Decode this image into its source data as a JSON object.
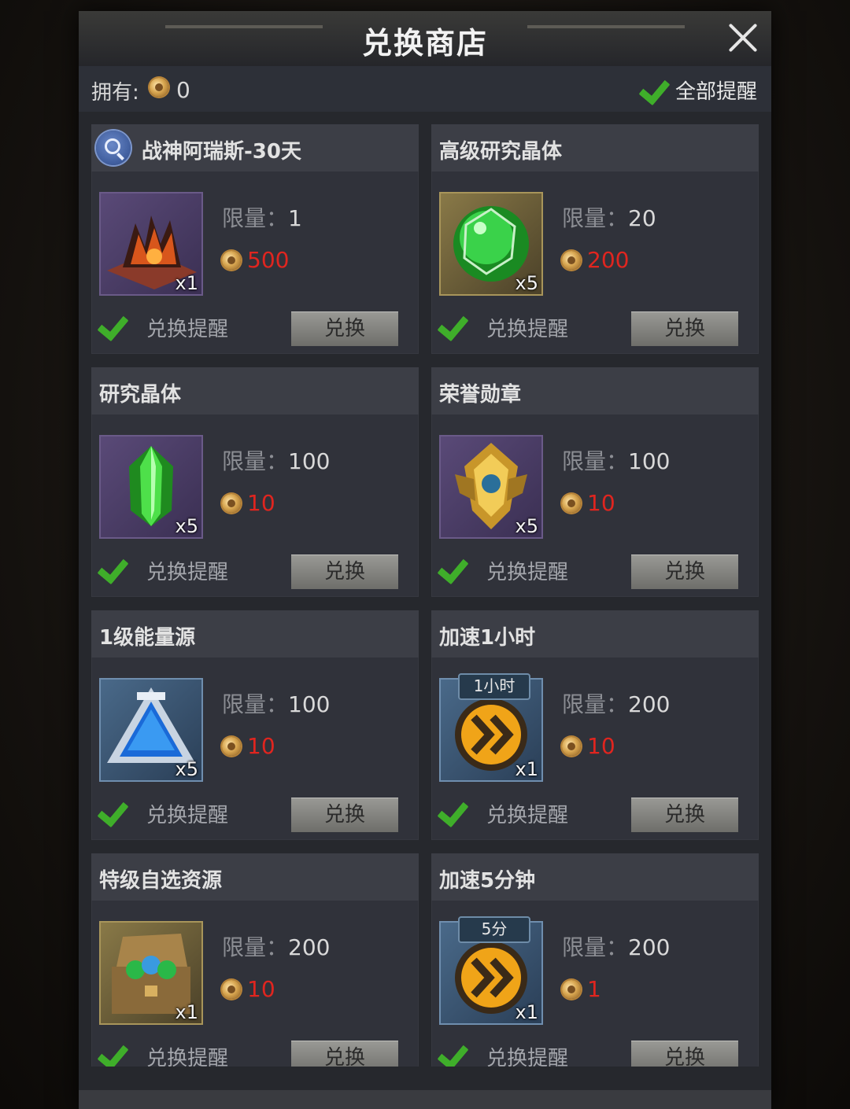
{
  "window": {
    "title": "兑换商店"
  },
  "owned": {
    "label": "拥有:",
    "count": "0"
  },
  "remind_all": {
    "label": "全部提醒"
  },
  "items": [
    {
      "title": "战神阿瑞斯-30天",
      "qty": "x1",
      "limit_label": "限量：",
      "limit": "1",
      "price": "500",
      "remind_label": "兑换提醒",
      "button_label": "兑换"
    },
    {
      "title": "高级研究晶体",
      "qty": "x5",
      "limit_label": "限量：",
      "limit": "20",
      "price": "200",
      "remind_label": "兑换提醒",
      "button_label": "兑换"
    },
    {
      "title": "研究晶体",
      "qty": "x5",
      "limit_label": "限量：",
      "limit": "100",
      "price": "10",
      "remind_label": "兑换提醒",
      "button_label": "兑换"
    },
    {
      "title": "荣誉勋章",
      "qty": "x5",
      "limit_label": "限量：",
      "limit": "100",
      "price": "10",
      "remind_label": "兑换提醒",
      "button_label": "兑换"
    },
    {
      "title": "1级能量源",
      "qty": "x5",
      "limit_label": "限量：",
      "limit": "100",
      "price": "10",
      "remind_label": "兑换提醒",
      "button_label": "兑换"
    },
    {
      "title": "加速1小时",
      "qty": "x1",
      "tag": "1小时",
      "limit_label": "限量：",
      "limit": "200",
      "price": "10",
      "remind_label": "兑换提醒",
      "button_label": "兑换"
    },
    {
      "title": "特级自选资源",
      "qty": "x1",
      "limit_label": "限量：",
      "limit": "200",
      "price": "10",
      "remind_label": "兑换提醒",
      "button_label": "兑换"
    },
    {
      "title": "加速5分钟",
      "qty": "x1",
      "tag": "5分",
      "limit_label": "限量：",
      "limit": "200",
      "price": "1",
      "remind_label": "兑换提醒",
      "button_label": "兑换"
    }
  ],
  "colors": {
    "price": "#e0251f",
    "check": "#3fae2a",
    "panel": "#26282d"
  },
  "icons": [
    "close-icon",
    "gold-coin-icon",
    "checkmark-icon",
    "search-icon"
  ]
}
